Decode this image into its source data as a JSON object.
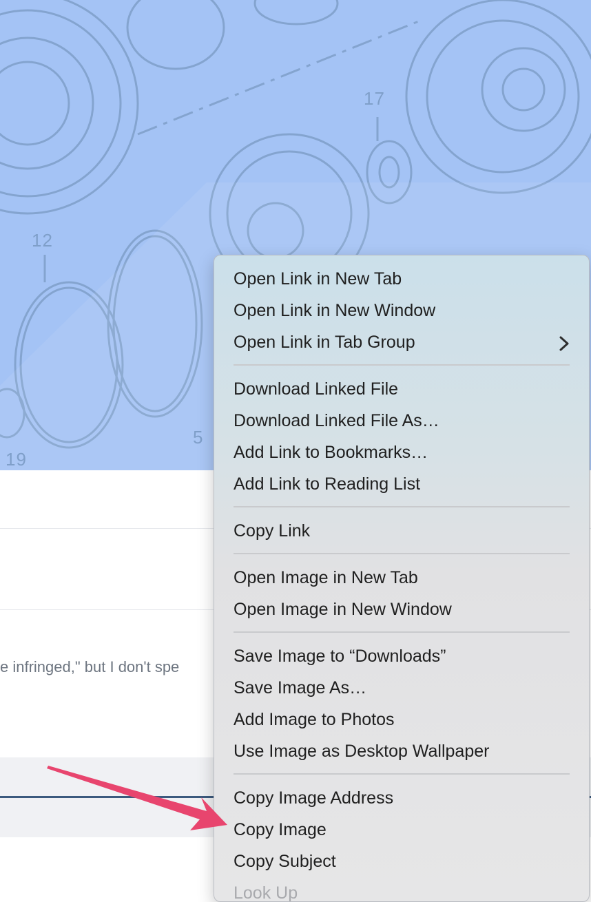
{
  "hero": {
    "part_labels": [
      "17",
      "12",
      "5",
      "19"
    ]
  },
  "page": {
    "snippet": "e infringed,\" but I don't spe"
  },
  "context_menu": {
    "groups": [
      {
        "items": [
          {
            "label": "Open Link in New Tab"
          },
          {
            "label": "Open Link in New Window"
          },
          {
            "label": "Open Link in Tab Group",
            "submenu_icon": "chevron-right-icon"
          }
        ]
      },
      {
        "items": [
          {
            "label": "Download Linked File"
          },
          {
            "label": "Download Linked File As…"
          },
          {
            "label": "Add Link to Bookmarks…"
          },
          {
            "label": "Add Link to Reading List"
          }
        ]
      },
      {
        "items": [
          {
            "label": "Copy Link"
          }
        ]
      },
      {
        "items": [
          {
            "label": "Open Image in New Tab"
          },
          {
            "label": "Open Image in New Window"
          }
        ]
      },
      {
        "items": [
          {
            "label": "Save Image to “Downloads”"
          },
          {
            "label": "Save Image As…"
          },
          {
            "label": "Add Image to Photos"
          },
          {
            "label": "Use Image as Desktop Wallpaper"
          }
        ]
      },
      {
        "items": [
          {
            "label": "Copy Image Address"
          },
          {
            "label": "Copy Image"
          },
          {
            "label": "Copy Subject"
          },
          {
            "label": "Look Up",
            "disabled": true
          }
        ]
      }
    ]
  },
  "annotation": {
    "arrow_color": "#e8456e",
    "icon": "pointer-arrow-icon"
  },
  "colors": {
    "hero_bg": "#a4c3f5",
    "drawing_line": "#7f9fc9",
    "menu_text": "#1f1f1f"
  }
}
